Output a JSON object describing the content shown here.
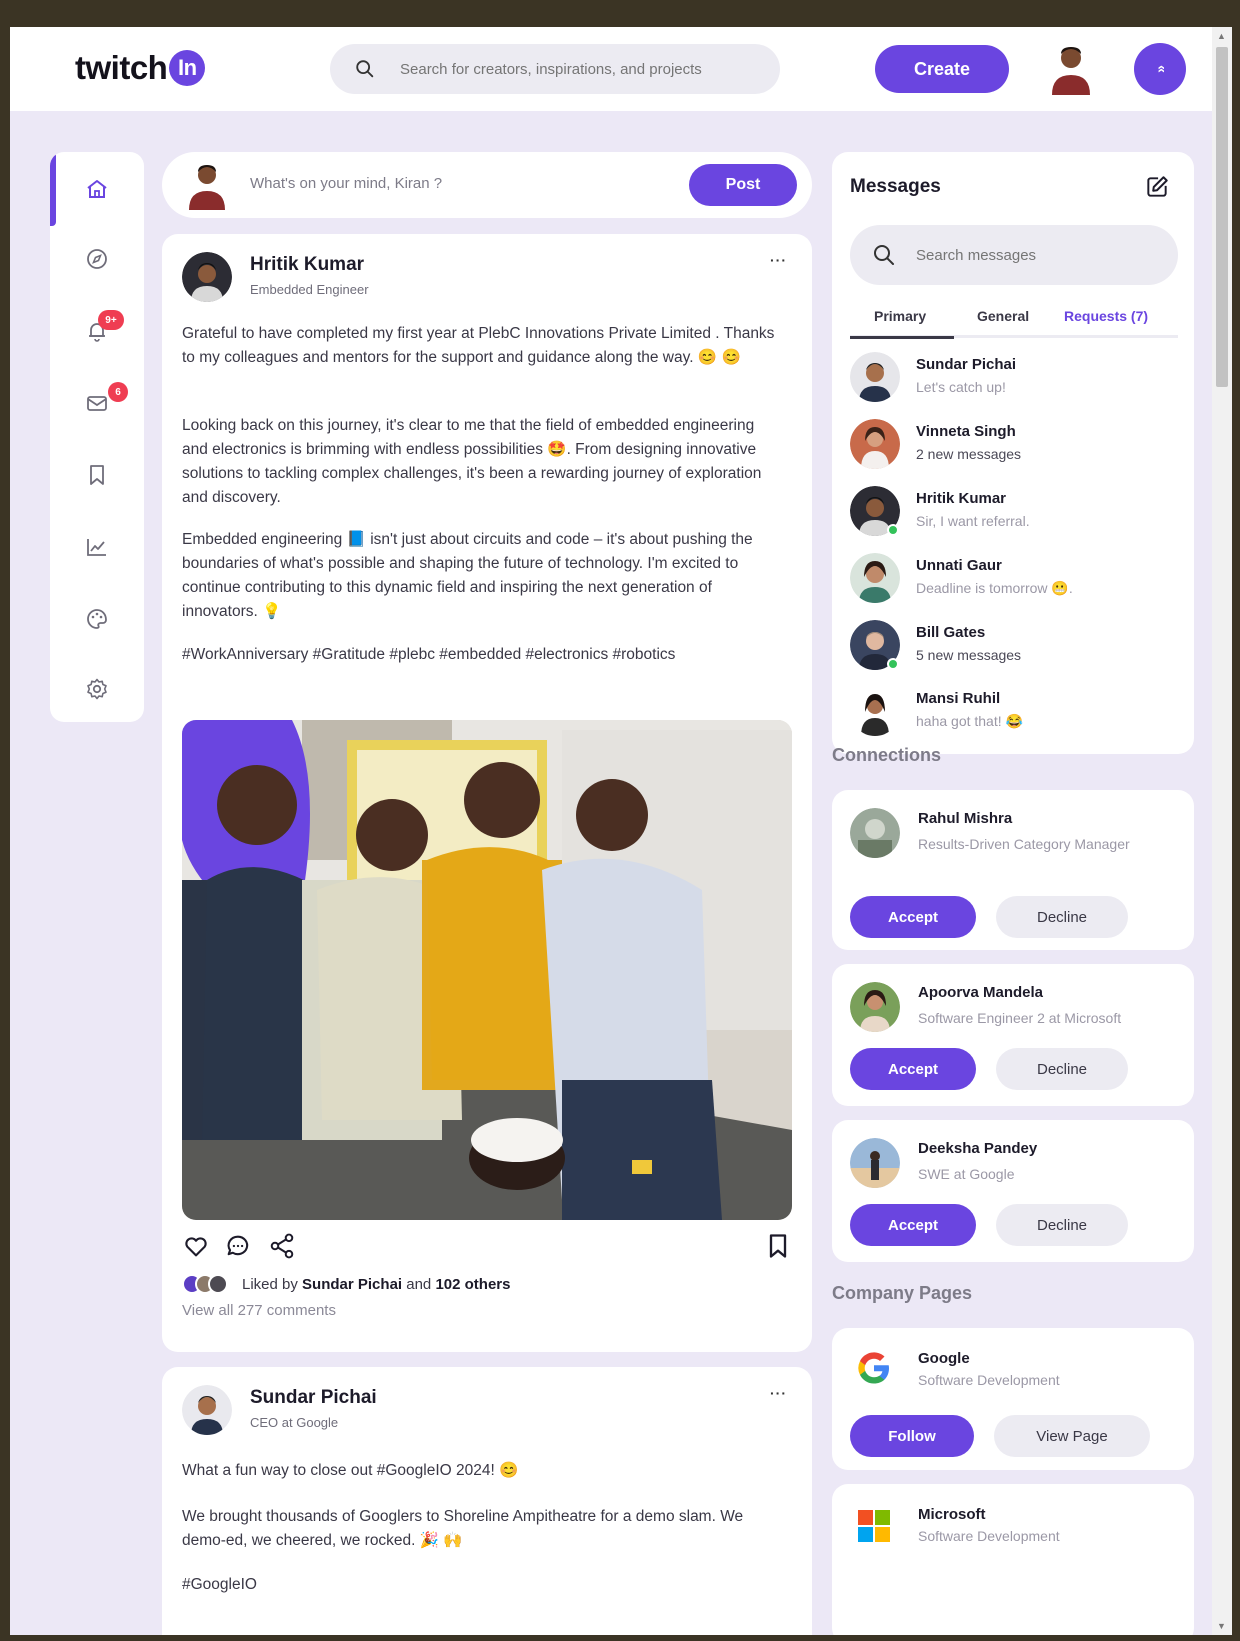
{
  "header": {
    "logo_text": "twitch",
    "logo_badge": "In",
    "search_placeholder": "Search for creators, inspirations, and projects",
    "create_label": "Create",
    "menu_glyph": "»"
  },
  "sidebar": {
    "items": [
      {
        "icon": "home-icon",
        "active": true
      },
      {
        "icon": "explore-icon"
      },
      {
        "icon": "notifications-icon",
        "badge": "9+"
      },
      {
        "icon": "mail-icon",
        "badge": "6"
      },
      {
        "icon": "bookmark-icon"
      },
      {
        "icon": "analytics-icon"
      },
      {
        "icon": "palette-icon"
      },
      {
        "icon": "settings-icon"
      }
    ]
  },
  "composer": {
    "placeholder": "What's on your mind, Kiran ?",
    "post_label": "Post"
  },
  "posts": [
    {
      "author": "Hritik Kumar",
      "role": "Embedded Engineer",
      "more": "···",
      "paragraphs": [
        "Grateful to have completed my first year at PlebC Innovations Private Limited . Thanks to my colleagues and mentors for the support and guidance along the way. 😊 😊",
        "Looking back on this journey, it's clear to me that the field of embedded engineering and electronics is brimming with endless possibilities 🤩. From designing innovative solutions to tackling complex challenges, it's been a rewarding journey of exploration and discovery.",
        "Embedded engineering 📘 isn't just about circuits and code – it's about pushing the boundaries of what's possible and shaping the future of technology. I'm excited to continue contributing to this dynamic field and inspiring the next generation of innovators. 💡",
        "#WorkAnniversary #Gratitude #plebc #embedded #electronics #robotics"
      ],
      "likes_prefix": "Liked by",
      "liked_by": "Sundar Pichai",
      "likes_and": "and",
      "likes_others": "102 others",
      "comments": "View all 277 comments"
    },
    {
      "author": "Sundar Pichai",
      "role": "CEO at Google",
      "more": "···",
      "paragraphs": [
        "What a fun way to close out #GoogleIO 2024! 😊",
        "We brought thousands of Googlers to Shoreline Ampitheatre for a demo slam. We demo-ed, we cheered, we rocked. 🎉 🙌",
        "#GoogleIO"
      ]
    }
  ],
  "messages": {
    "title": "Messages",
    "search_placeholder": "Search messages",
    "tabs": [
      "Primary",
      "General",
      "Requests (7)"
    ],
    "items": [
      {
        "name": "Sundar Pichai",
        "text": "Let's catch up!",
        "online": false,
        "unread": false
      },
      {
        "name": "Vinneta Singh",
        "text": "2 new messages",
        "online": false,
        "unread": true
      },
      {
        "name": "Hritik Kumar",
        "text": "Sir, I want referral.",
        "online": true,
        "unread": false
      },
      {
        "name": "Unnati Gaur",
        "text": "Deadline is tomorrow 😬.",
        "online": false,
        "unread": false
      },
      {
        "name": "Bill Gates",
        "text": "5 new messages",
        "online": true,
        "unread": true
      },
      {
        "name": "Mansi Ruhil",
        "text": "haha got that! 😂",
        "online": false,
        "unread": false
      }
    ]
  },
  "connections": {
    "title": "Connections",
    "accept_label": "Accept",
    "decline_label": "Decline",
    "items": [
      {
        "name": "Rahul Mishra",
        "desc": "Results-Driven Category Manager"
      },
      {
        "name": "Apoorva Mandela",
        "desc": "Software Engineer 2 at Microsoft"
      },
      {
        "name": "Deeksha Pandey",
        "desc": "SWE at Google"
      }
    ]
  },
  "company_pages": {
    "title": "Company Pages",
    "follow_label": "Follow",
    "view_label": "View Page",
    "items": [
      {
        "name": "Google",
        "desc": "Software Development"
      },
      {
        "name": "Microsoft",
        "desc": "Software Development"
      }
    ]
  },
  "colors": {
    "accent": "#6a45e0",
    "badge": "#ef3d52",
    "background": "#ece8f6"
  }
}
